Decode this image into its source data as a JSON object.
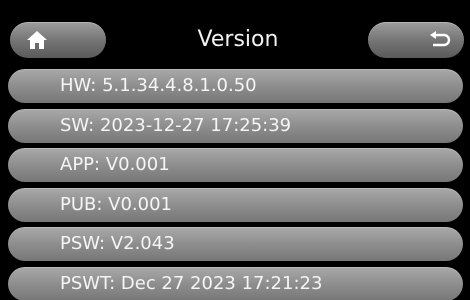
{
  "header": {
    "title": "Version",
    "home_icon": "home-icon",
    "back_icon": "back-arrow-icon"
  },
  "rows": [
    {
      "text": "HW: 5.1.34.4.8.1.0.50"
    },
    {
      "text": "SW: 2023-12-27 17:25:39"
    },
    {
      "text": "APP: V0.001"
    },
    {
      "text": "PUB: V0.001"
    },
    {
      "text": "PSW: V2.043"
    },
    {
      "text": "PSWT: Dec 27 2023 17:21:23"
    }
  ],
  "colors": {
    "background": "#000000",
    "button": "#8a8a8a",
    "text": "#f5f5f5"
  }
}
